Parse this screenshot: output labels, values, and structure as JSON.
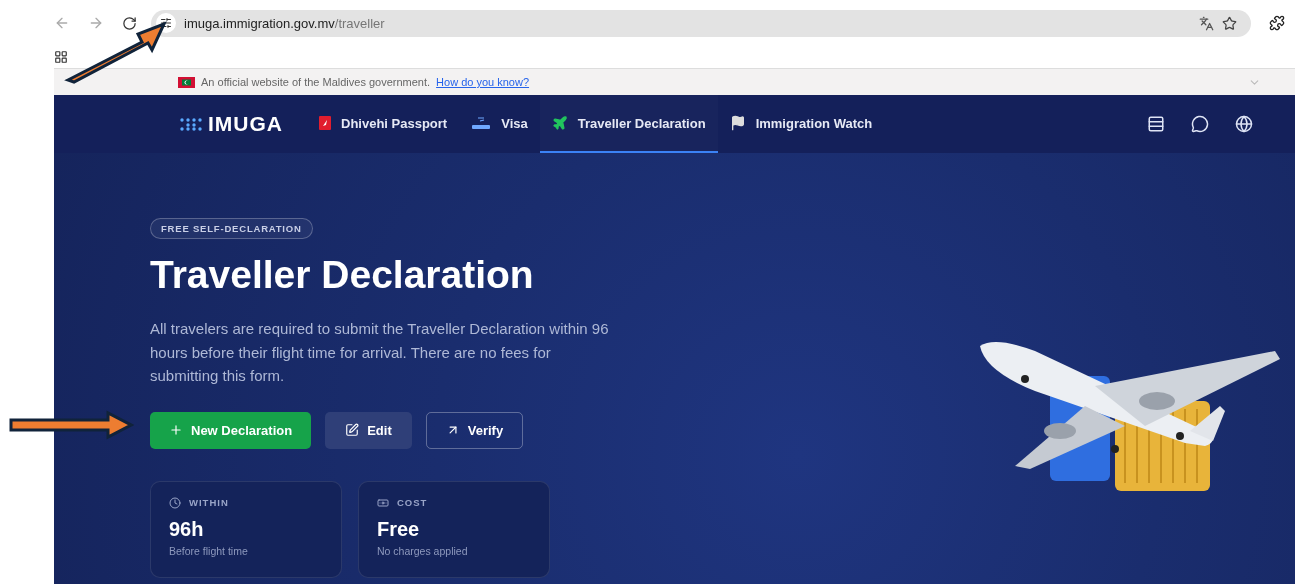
{
  "browser": {
    "url_host": "imuga.immigration.gov.mv",
    "url_path": "/traveller"
  },
  "official_banner": {
    "text": "An official website of the Maldives government.",
    "link": "How do you know?"
  },
  "nav": {
    "logo": "IMUGA",
    "tabs": [
      {
        "label": "Dhivehi Passport",
        "selected": false
      },
      {
        "label": "Visa",
        "selected": false
      },
      {
        "label": "Traveller Declaration",
        "selected": true
      },
      {
        "label": "Immigration Watch",
        "selected": false
      }
    ]
  },
  "hero": {
    "badge": "FREE SELF-DECLARATION",
    "title": "Traveller Declaration",
    "description": "All travelers are required to submit the Traveller Declaration within 96 hours before their flight time for arrival. There are no fees for submitting this form.",
    "buttons": [
      {
        "label": "New Declaration",
        "kind": "primary"
      },
      {
        "label": "Edit",
        "kind": "secondary"
      },
      {
        "label": "Verify",
        "kind": "outline"
      }
    ],
    "cards": [
      {
        "label": "WITHIN",
        "value": "96h",
        "note": "Before flight time"
      },
      {
        "label": "COST",
        "value": "Free",
        "note": "No charges applied"
      }
    ]
  }
}
